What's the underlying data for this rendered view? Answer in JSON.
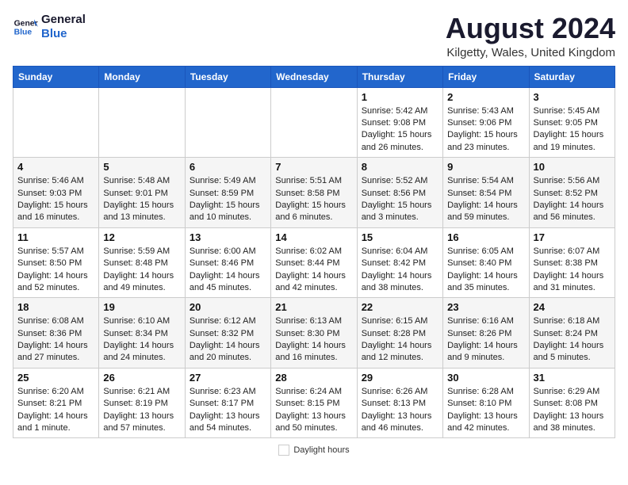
{
  "header": {
    "logo_line1": "General",
    "logo_line2": "Blue",
    "month": "August 2024",
    "location": "Kilgetty, Wales, United Kingdom"
  },
  "days_of_week": [
    "Sunday",
    "Monday",
    "Tuesday",
    "Wednesday",
    "Thursday",
    "Friday",
    "Saturday"
  ],
  "weeks": [
    [
      {
        "day": "",
        "info": ""
      },
      {
        "day": "",
        "info": ""
      },
      {
        "day": "",
        "info": ""
      },
      {
        "day": "",
        "info": ""
      },
      {
        "day": "1",
        "info": "Sunrise: 5:42 AM\nSunset: 9:08 PM\nDaylight: 15 hours\nand 26 minutes."
      },
      {
        "day": "2",
        "info": "Sunrise: 5:43 AM\nSunset: 9:06 PM\nDaylight: 15 hours\nand 23 minutes."
      },
      {
        "day": "3",
        "info": "Sunrise: 5:45 AM\nSunset: 9:05 PM\nDaylight: 15 hours\nand 19 minutes."
      }
    ],
    [
      {
        "day": "4",
        "info": "Sunrise: 5:46 AM\nSunset: 9:03 PM\nDaylight: 15 hours\nand 16 minutes."
      },
      {
        "day": "5",
        "info": "Sunrise: 5:48 AM\nSunset: 9:01 PM\nDaylight: 15 hours\nand 13 minutes."
      },
      {
        "day": "6",
        "info": "Sunrise: 5:49 AM\nSunset: 8:59 PM\nDaylight: 15 hours\nand 10 minutes."
      },
      {
        "day": "7",
        "info": "Sunrise: 5:51 AM\nSunset: 8:58 PM\nDaylight: 15 hours\nand 6 minutes."
      },
      {
        "day": "8",
        "info": "Sunrise: 5:52 AM\nSunset: 8:56 PM\nDaylight: 15 hours\nand 3 minutes."
      },
      {
        "day": "9",
        "info": "Sunrise: 5:54 AM\nSunset: 8:54 PM\nDaylight: 14 hours\nand 59 minutes."
      },
      {
        "day": "10",
        "info": "Sunrise: 5:56 AM\nSunset: 8:52 PM\nDaylight: 14 hours\nand 56 minutes."
      }
    ],
    [
      {
        "day": "11",
        "info": "Sunrise: 5:57 AM\nSunset: 8:50 PM\nDaylight: 14 hours\nand 52 minutes."
      },
      {
        "day": "12",
        "info": "Sunrise: 5:59 AM\nSunset: 8:48 PM\nDaylight: 14 hours\nand 49 minutes."
      },
      {
        "day": "13",
        "info": "Sunrise: 6:00 AM\nSunset: 8:46 PM\nDaylight: 14 hours\nand 45 minutes."
      },
      {
        "day": "14",
        "info": "Sunrise: 6:02 AM\nSunset: 8:44 PM\nDaylight: 14 hours\nand 42 minutes."
      },
      {
        "day": "15",
        "info": "Sunrise: 6:04 AM\nSunset: 8:42 PM\nDaylight: 14 hours\nand 38 minutes."
      },
      {
        "day": "16",
        "info": "Sunrise: 6:05 AM\nSunset: 8:40 PM\nDaylight: 14 hours\nand 35 minutes."
      },
      {
        "day": "17",
        "info": "Sunrise: 6:07 AM\nSunset: 8:38 PM\nDaylight: 14 hours\nand 31 minutes."
      }
    ],
    [
      {
        "day": "18",
        "info": "Sunrise: 6:08 AM\nSunset: 8:36 PM\nDaylight: 14 hours\nand 27 minutes."
      },
      {
        "day": "19",
        "info": "Sunrise: 6:10 AM\nSunset: 8:34 PM\nDaylight: 14 hours\nand 24 minutes."
      },
      {
        "day": "20",
        "info": "Sunrise: 6:12 AM\nSunset: 8:32 PM\nDaylight: 14 hours\nand 20 minutes."
      },
      {
        "day": "21",
        "info": "Sunrise: 6:13 AM\nSunset: 8:30 PM\nDaylight: 14 hours\nand 16 minutes."
      },
      {
        "day": "22",
        "info": "Sunrise: 6:15 AM\nSunset: 8:28 PM\nDaylight: 14 hours\nand 12 minutes."
      },
      {
        "day": "23",
        "info": "Sunrise: 6:16 AM\nSunset: 8:26 PM\nDaylight: 14 hours\nand 9 minutes."
      },
      {
        "day": "24",
        "info": "Sunrise: 6:18 AM\nSunset: 8:24 PM\nDaylight: 14 hours\nand 5 minutes."
      }
    ],
    [
      {
        "day": "25",
        "info": "Sunrise: 6:20 AM\nSunset: 8:21 PM\nDaylight: 14 hours\nand 1 minute."
      },
      {
        "day": "26",
        "info": "Sunrise: 6:21 AM\nSunset: 8:19 PM\nDaylight: 13 hours\nand 57 minutes."
      },
      {
        "day": "27",
        "info": "Sunrise: 6:23 AM\nSunset: 8:17 PM\nDaylight: 13 hours\nand 54 minutes."
      },
      {
        "day": "28",
        "info": "Sunrise: 6:24 AM\nSunset: 8:15 PM\nDaylight: 13 hours\nand 50 minutes."
      },
      {
        "day": "29",
        "info": "Sunrise: 6:26 AM\nSunset: 8:13 PM\nDaylight: 13 hours\nand 46 minutes."
      },
      {
        "day": "30",
        "info": "Sunrise: 6:28 AM\nSunset: 8:10 PM\nDaylight: 13 hours\nand 42 minutes."
      },
      {
        "day": "31",
        "info": "Sunrise: 6:29 AM\nSunset: 8:08 PM\nDaylight: 13 hours\nand 38 minutes."
      }
    ]
  ],
  "footer": {
    "daylight_label": "Daylight hours"
  }
}
